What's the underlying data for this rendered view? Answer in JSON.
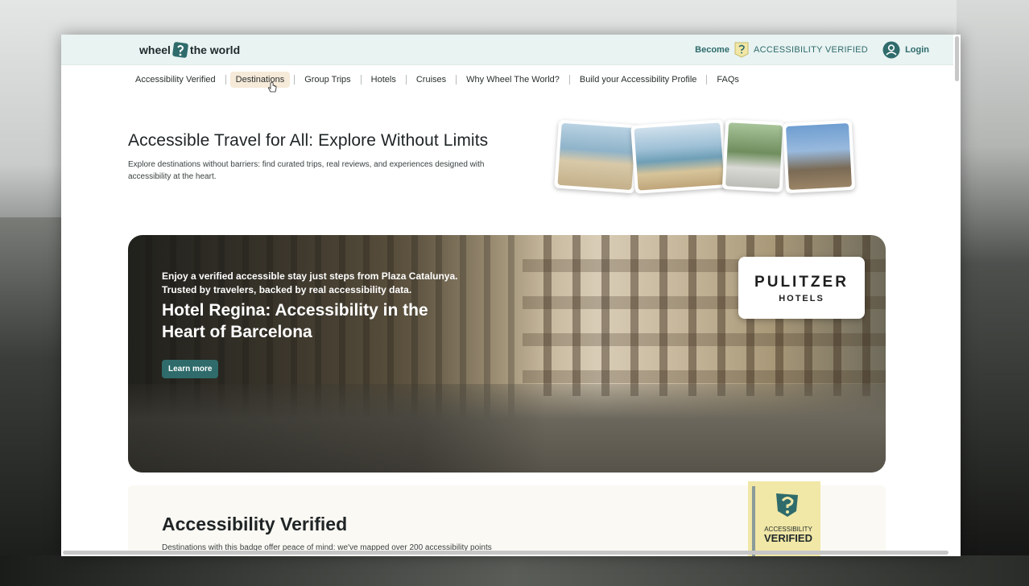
{
  "header": {
    "logo_left": "wheel",
    "logo_right": "the world",
    "become": "Become",
    "accessibility_verified": "ACCESSIBILITY VERIFIED",
    "login": "Login"
  },
  "nav": {
    "items": [
      {
        "label": "Accessibility Verified"
      },
      {
        "label": "Destinations"
      },
      {
        "label": "Group Trips"
      },
      {
        "label": "Hotels"
      },
      {
        "label": "Cruises"
      },
      {
        "label": "Why Wheel The World?"
      },
      {
        "label": "Build your Accessibility Profile"
      },
      {
        "label": "FAQs"
      }
    ],
    "active": "Destinations"
  },
  "hero": {
    "title": "Accessible Travel for All: Explore Without Limits",
    "subtitle": "Explore destinations without barriers: find curated trips, real reviews, and experiences designed with accessibility at the heart."
  },
  "banner": {
    "kicker": "Enjoy a verified accessible stay just steps from Plaza Catalunya. Trusted by travelers, backed by real accessibility data.",
    "title": "Hotel Regina: Accessibility in the Heart of Barcelona",
    "button": "Learn more",
    "partner_name": "PULITZER",
    "partner_sub": "HOTELS"
  },
  "verified_section": {
    "title": "Accessibility Verified",
    "description": "Destinations with this badge offer peace of mind: we've mapped over 200 accessibility points",
    "badge_line1": "ACCESSIBILITY",
    "badge_line2": "VERIFIED"
  },
  "colors": {
    "brand_teal": "#2f6b6b",
    "topbar_bg": "#e8f3f2",
    "active_nav_bg": "#f6ead9",
    "badge_yellow": "#f1e7a6"
  }
}
